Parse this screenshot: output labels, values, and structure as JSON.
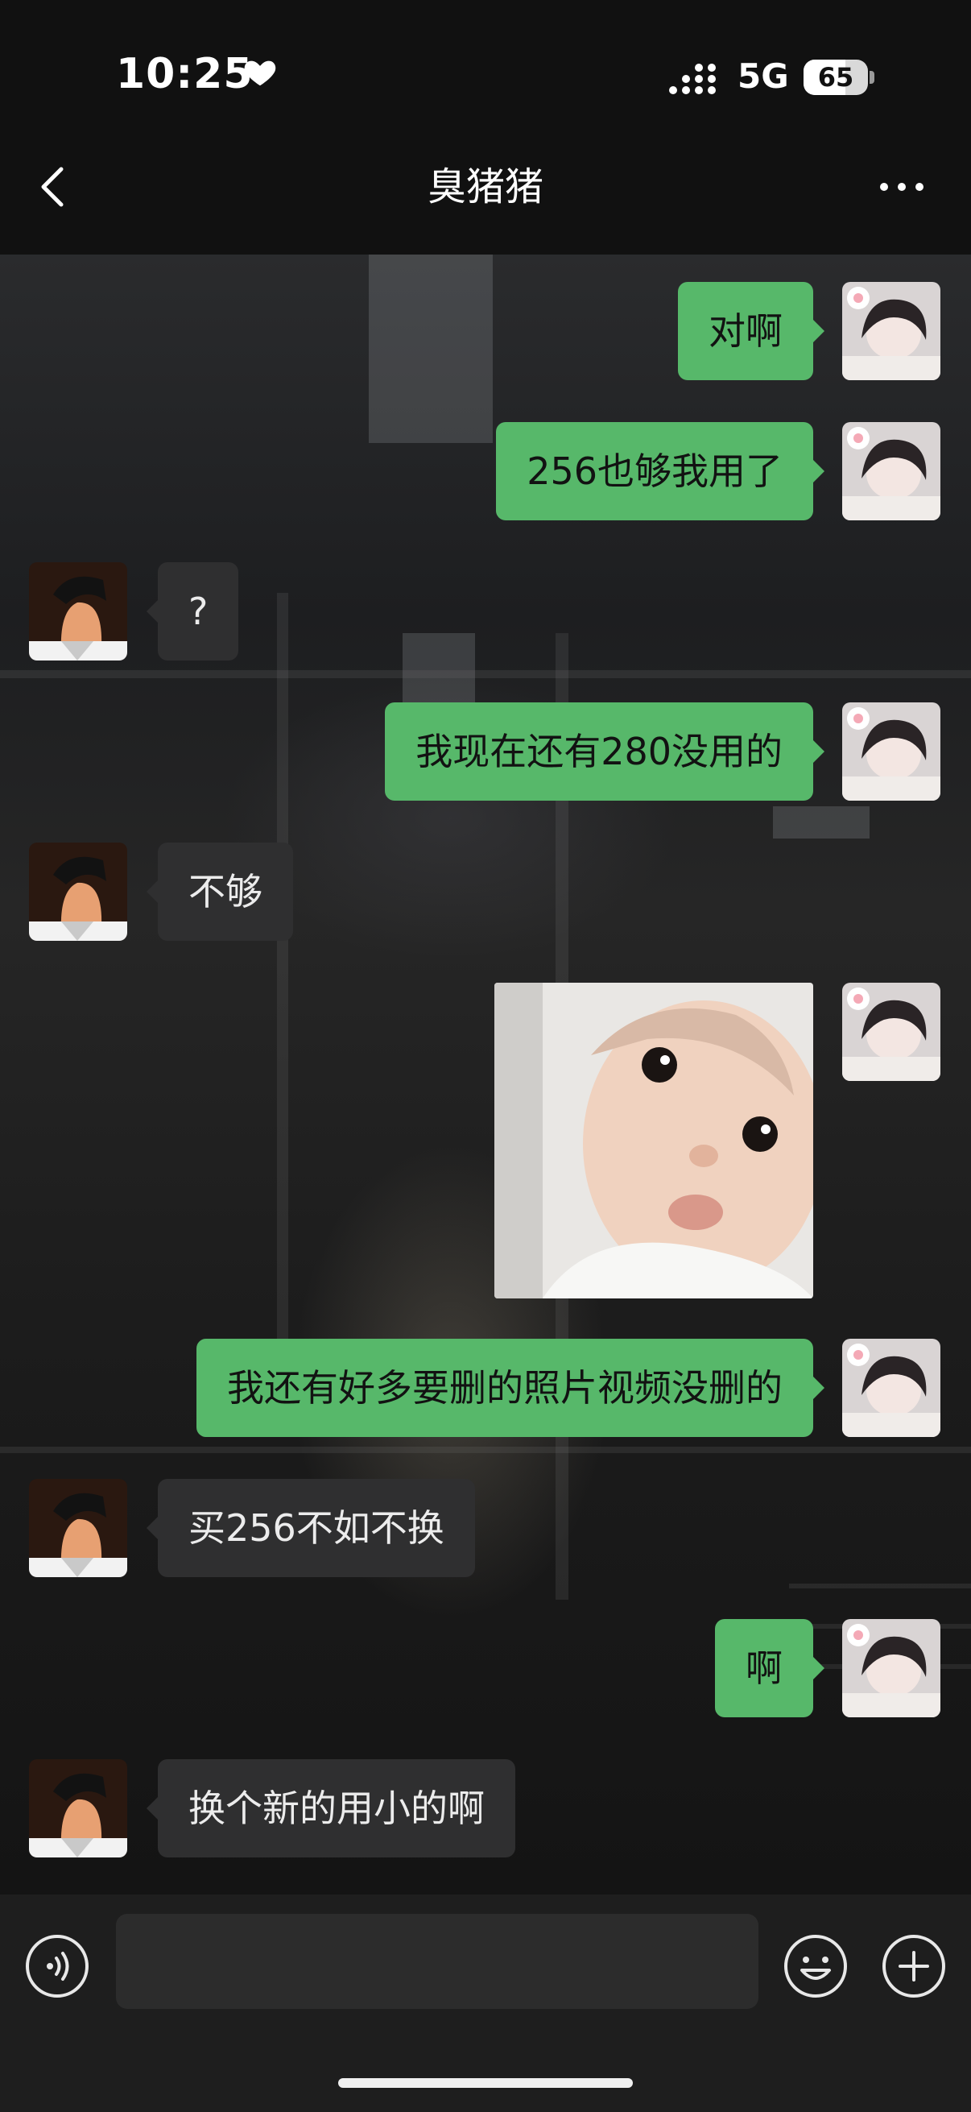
{
  "status_bar": {
    "time": "10:25",
    "network": "5G",
    "battery": "65",
    "battery_level": 0.65
  },
  "header": {
    "title": "臭猪猪"
  },
  "messages": [
    {
      "side": "out",
      "type": "text",
      "text": "对啊"
    },
    {
      "side": "out",
      "type": "text",
      "text": "256也够我用了"
    },
    {
      "side": "in",
      "type": "text",
      "text": "?"
    },
    {
      "side": "out",
      "type": "text",
      "text": "我现在还有280没用的"
    },
    {
      "side": "in",
      "type": "text",
      "text": "不够"
    },
    {
      "side": "out",
      "type": "image"
    },
    {
      "side": "out",
      "type": "text",
      "text": "我还有好多要删的照片视频没删的"
    },
    {
      "side": "in",
      "type": "text",
      "text": "买256不如不换"
    },
    {
      "side": "out",
      "type": "text",
      "text": "啊"
    },
    {
      "side": "in",
      "type": "text",
      "text": "换个新的用小的啊"
    }
  ],
  "input": {
    "placeholder": ""
  },
  "icons": {
    "status": [
      "heart-icon",
      "signal-icon",
      "battery-icon"
    ],
    "nav": [
      "back-icon",
      "more-icon"
    ],
    "input": [
      "voice-icon",
      "emoji-icon",
      "plus-icon"
    ]
  },
  "colors": {
    "outgoing_bubble": "#57b86a",
    "incoming_bubble": "#2f2f30",
    "background": "#111111"
  }
}
